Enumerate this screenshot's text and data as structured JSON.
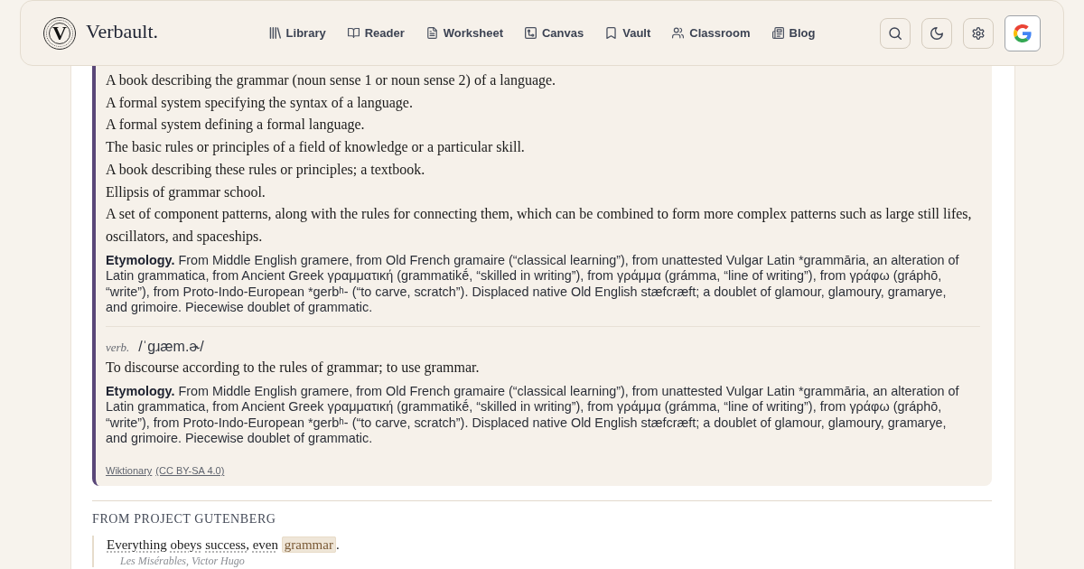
{
  "header": {
    "logo_mark": "V",
    "logo_text": "Verbault.",
    "nav": [
      {
        "label": "Library"
      },
      {
        "label": "Reader"
      },
      {
        "label": "Worksheet"
      },
      {
        "label": "Canvas"
      },
      {
        "label": "Vault"
      },
      {
        "label": "Classroom"
      },
      {
        "label": "Blog"
      }
    ]
  },
  "wiktionary": {
    "entries": [
      {
        "definitions": [
          "A book describing the grammar (noun sense 1 or noun sense 2) of a language.",
          "A formal system specifying the syntax of a language.",
          "A formal system defining a formal language.",
          "The basic rules or principles of a field of knowledge or a particular skill.",
          "A book describing these rules or principles; a textbook.",
          "Ellipsis of grammar school.",
          "A set of component patterns, along with the rules for connecting them, which can be combined to form more complex patterns such as large still lifes, oscillators, and spaceships."
        ],
        "etymology_label": "Etymology.",
        "etymology": "From Middle English gramere, from Old French gramaire (“classical learning”), from unattested Vulgar Latin *grammāria, an alteration of Latin grammatica, from Ancient Greek γραμματική (grammatikḗ, “skilled in writing”), from γράμμα (grámma, “line of writing”), from γράφω (gráphō, “write”), from Proto-Indo-European *gerbʰ- (“to carve, scratch”). Displaced native Old English stæfcræft; a doublet of glamour, glamoury, gramarye, and grimoire. Piecewise doublet of grammatic."
      },
      {
        "pos": "verb.",
        "pronunciation": "/ˈɡɹæm.ɚ/",
        "definitions": [
          "To discourse according to the rules of grammar; to use grammar."
        ],
        "etymology_label": "Etymology.",
        "etymology": "From Middle English gramere, from Old French gramaire (“classical learning”), from unattested Vulgar Latin *grammāria, an alteration of Latin grammatica, from Ancient Greek γραμματική (grammatikḗ, “skilled in writing”), from γράμμα (grámma, “line of writing”), from γράφω (gráphō, “write”), from Proto-Indo-European *gerbʰ- (“to carve, scratch”). Displaced native Old English stæfcræft; a doublet of glamour, glamoury, gramarye, and grimoire. Piecewise doublet of grammatic."
      }
    ],
    "source": "Wiktionary",
    "license": "(CC BY-SA 4.0)"
  },
  "gutenberg": {
    "heading": "FROM PROJECT GUTENBERG",
    "quotes": [
      {
        "tokens": [
          {
            "text": "Everything",
            "kind": "word"
          },
          {
            "text": "obeys",
            "kind": "word"
          },
          {
            "text": "success,",
            "kind": "word"
          },
          {
            "text": "even",
            "kind": "word"
          },
          {
            "text": "grammar",
            "kind": "match"
          },
          {
            "text": ".",
            "kind": "punct"
          }
        ],
        "source": "Les Misérables, Victor Hugo"
      }
    ]
  }
}
